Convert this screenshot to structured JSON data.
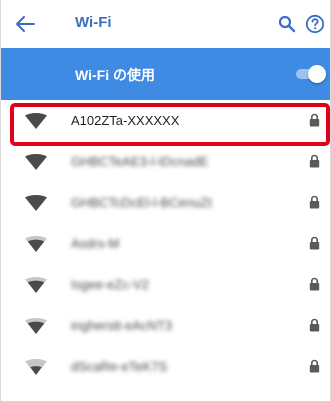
{
  "header": {
    "title": "Wi-Fi",
    "back_icon": "arrow-left-icon",
    "search_icon": "search-icon",
    "help_icon": "help-circle-icon",
    "accent_color": "#3b6fc4"
  },
  "master_switch": {
    "label": "Wi-Fi の使用",
    "state": "on",
    "bar_color": "#3f8ae2"
  },
  "networks": [
    {
      "ssid": "A102ZTa-XXXXXX",
      "secured": true,
      "signal": "strong",
      "blurred": false,
      "highlighted": true
    },
    {
      "ssid": "GHBCTeAE3-l-IDcnadE",
      "secured": true,
      "signal": "strong",
      "blurred": true,
      "highlighted": false
    },
    {
      "ssid": "GHBCTcDcEl-l-BCenuZt",
      "secured": true,
      "signal": "strong",
      "blurred": true,
      "highlighted": false
    },
    {
      "ssid": "Asdrs-M",
      "secured": true,
      "signal": "medium",
      "blurred": true,
      "highlighted": false
    },
    {
      "ssid": "Isgee-eZc-V2",
      "secured": true,
      "signal": "medium",
      "blurred": true,
      "highlighted": false
    },
    {
      "ssid": "ingherstt-eAcNT3",
      "secured": true,
      "signal": "medium",
      "blurred": true,
      "highlighted": false
    },
    {
      "ssid": "dScaRe-eTeK7S",
      "secured": true,
      "signal": "weak",
      "blurred": true,
      "highlighted": false
    }
  ],
  "highlight_color": "#e0001b"
}
